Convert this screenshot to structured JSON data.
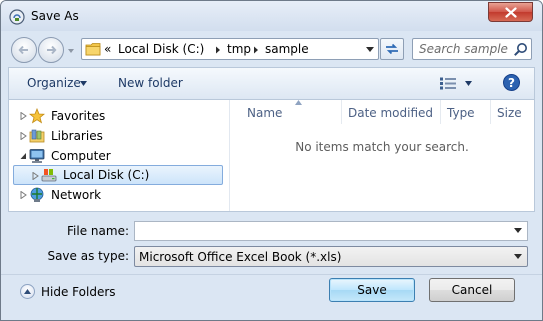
{
  "window": {
    "title": "Save As"
  },
  "address": {
    "overflow": "«",
    "segments": [
      "Local Disk (C:)",
      "tmp",
      "sample"
    ]
  },
  "search": {
    "placeholder": "Search sample"
  },
  "toolbar": {
    "organize_label": "Organize",
    "new_folder_label": "New folder"
  },
  "nav_tree": [
    {
      "label": "Favorites",
      "icon": "star-icon"
    },
    {
      "label": "Libraries",
      "icon": "library-icon"
    },
    {
      "label": "Computer",
      "icon": "computer-icon"
    },
    {
      "label": "Local Disk (C:)",
      "icon": "drive-icon",
      "selected": true
    },
    {
      "label": "Network",
      "icon": "network-icon"
    }
  ],
  "columns": [
    "Name",
    "Date modified",
    "Type",
    "Size"
  ],
  "empty_message": "No items match your search.",
  "file_name": {
    "label": "File name:",
    "value": ""
  },
  "save_type": {
    "label": "Save as type:",
    "value": "Microsoft Office Excel Book (*.xls)"
  },
  "hide_folders_label": "Hide Folders",
  "buttons": {
    "save": "Save",
    "cancel": "Cancel"
  },
  "colors": {
    "accent": "#3c7fb1",
    "close": "#c23a2d",
    "selection": "#cde4fa"
  }
}
